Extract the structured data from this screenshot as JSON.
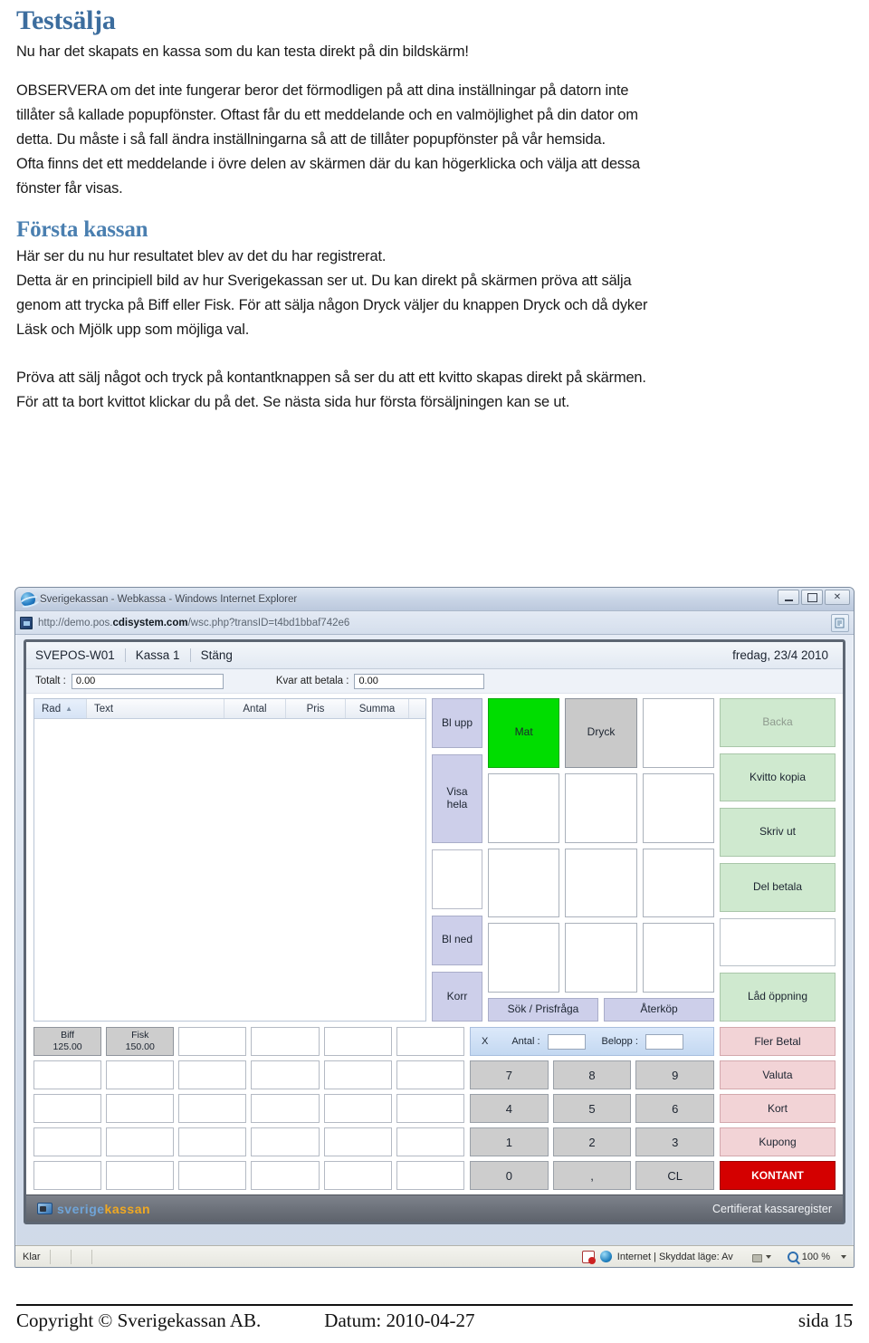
{
  "document": {
    "heading1": "Testsälja",
    "intro": "Nu har det skapats en kassa som du kan testa direkt på din bildskärm!",
    "para1_line1": "OBSERVERA om det inte fungerar beror det förmodligen på att dina inställningar på datorn inte",
    "para1_line2": "tillåter så kallade popupfönster. Oftast får du ett meddelande och en valmöjlighet på din dator om",
    "para1_line3": "detta. Du måste i så fall ändra inställningarna så att de tillåter popupfönster på vår hemsida.",
    "para1_line4": "Ofta finns det ett meddelande i övre delen av skärmen där du kan högerklicka och välja att dessa",
    "para1_line5": "fönster får visas.",
    "heading2": "Första kassan",
    "para2_line1": "Här ser du nu hur resultatet blev av det du har registrerat.",
    "para2_line2": "Detta är en principiell bild av hur Sverigekassan ser ut. Du kan direkt på skärmen pröva att sälja",
    "para2_line3": "genom att trycka på Biff eller Fisk. För att sälja någon Dryck väljer du knappen Dryck och då dyker",
    "para2_line4": "Läsk och Mjölk upp som möjliga val.",
    "para3_line1": "Pröva att sälj något och tryck på kontantknappen så ser du att ett kvitto skapas direkt på skärmen.",
    "para3_line2": "För att ta bort kvittot klickar du på det. Se nästa sida hur första försäljningen kan se ut."
  },
  "browser": {
    "title": "Sverigekassan - Webkassa - Windows Internet Explorer",
    "url_scheme": "http://demo.pos.",
    "url_domain": "cdisystem.com",
    "url_path": "/wsc.php?transID=t4bd1bbaf742e6",
    "minimize_label": "Minimera",
    "maximize_label": "Maximera",
    "close_label": "✕",
    "statusbar": {
      "status": "Klar",
      "zone": "Internet | Skyddat läge: Av",
      "zoom": "100 %"
    }
  },
  "pos": {
    "topbar": {
      "terminal": "SVEPOS-W01",
      "register": "Kassa 1",
      "close": "Stäng",
      "date": "fredag, 23/4 2010"
    },
    "totals": {
      "total_label": "Totalt :",
      "total_value": "0.00",
      "remaining_label": "Kvar att betala :",
      "remaining_value": "0.00"
    },
    "receipt": {
      "columns": [
        "Rad",
        "Text",
        "Antal",
        "Pris",
        "Summa"
      ],
      "rows": []
    },
    "nav_buttons": [
      {
        "label": "Bl upp",
        "style": "nav"
      },
      {
        "label": "Visa\nhela",
        "style": "nav"
      },
      {
        "label": "",
        "style": "blank"
      },
      {
        "label": "Bl ned",
        "style": "nav"
      },
      {
        "label": "Korr",
        "style": "nav"
      }
    ],
    "dept_grid": [
      [
        {
          "label": "Mat",
          "style": "green"
        },
        {
          "label": "Dryck",
          "style": "sel"
        },
        {
          "label": "",
          "style": "plu"
        }
      ],
      [
        {
          "label": "",
          "style": "plu"
        },
        {
          "label": "",
          "style": "plu"
        },
        {
          "label": "",
          "style": "plu"
        }
      ],
      [
        {
          "label": "",
          "style": "plu"
        },
        {
          "label": "",
          "style": "plu"
        },
        {
          "label": "",
          "style": "plu"
        }
      ],
      [
        {
          "label": "",
          "style": "plu"
        },
        {
          "label": "",
          "style": "plu"
        },
        {
          "label": "",
          "style": "plu"
        }
      ]
    ],
    "wide_buttons": [
      "Sök / Prisfråga",
      "Återköp"
    ],
    "function_buttons": [
      {
        "label": "Backa",
        "disabled": true
      },
      {
        "label": "Kvitto kopia",
        "disabled": false
      },
      {
        "label": "Skriv ut",
        "disabled": false
      },
      {
        "label": "Del betala",
        "disabled": false
      },
      {
        "label": "",
        "blank": true
      },
      {
        "label": "Låd öppning",
        "disabled": false
      }
    ],
    "plu_grid": [
      {
        "name": "Biff",
        "price": "125.00",
        "filled": true
      },
      {
        "name": "Fisk",
        "price": "150.00",
        "filled": true
      },
      {
        "name": "",
        "price": "",
        "filled": false
      },
      {
        "name": "",
        "price": "",
        "filled": false
      },
      {
        "name": "",
        "price": "",
        "filled": false
      },
      {
        "name": "",
        "price": "",
        "filled": false
      },
      {
        "name": "",
        "price": "",
        "filled": false
      },
      {
        "name": "",
        "price": "",
        "filled": false
      },
      {
        "name": "",
        "price": "",
        "filled": false
      },
      {
        "name": "",
        "price": "",
        "filled": false
      },
      {
        "name": "",
        "price": "",
        "filled": false
      },
      {
        "name": "",
        "price": "",
        "filled": false
      },
      {
        "name": "",
        "price": "",
        "filled": false
      },
      {
        "name": "",
        "price": "",
        "filled": false
      },
      {
        "name": "",
        "price": "",
        "filled": false
      },
      {
        "name": "",
        "price": "",
        "filled": false
      },
      {
        "name": "",
        "price": "",
        "filled": false
      },
      {
        "name": "",
        "price": "",
        "filled": false
      },
      {
        "name": "",
        "price": "",
        "filled": false
      },
      {
        "name": "",
        "price": "",
        "filled": false
      },
      {
        "name": "",
        "price": "",
        "filled": false
      },
      {
        "name": "",
        "price": "",
        "filled": false
      },
      {
        "name": "",
        "price": "",
        "filled": false
      },
      {
        "name": "",
        "price": "",
        "filled": false
      },
      {
        "name": "",
        "price": "",
        "filled": false
      },
      {
        "name": "",
        "price": "",
        "filled": false
      },
      {
        "name": "",
        "price": "",
        "filled": false
      },
      {
        "name": "",
        "price": "",
        "filled": false
      },
      {
        "name": "",
        "price": "",
        "filled": false
      },
      {
        "name": "",
        "price": "",
        "filled": false
      }
    ],
    "qtybar": {
      "multiply": "X",
      "qty_label": "Antal :",
      "qty_value": "",
      "amount_label": "Belopp :",
      "amount_value": ""
    },
    "numpad": [
      [
        "7",
        "8",
        "9"
      ],
      [
        "4",
        "5",
        "6"
      ],
      [
        "1",
        "2",
        "3"
      ],
      [
        "0",
        ",",
        "CL"
      ]
    ],
    "payment_buttons": [
      {
        "label": "Fler Betal",
        "primary": false
      },
      {
        "label": "Valuta",
        "primary": false
      },
      {
        "label": "Kort",
        "primary": false
      },
      {
        "label": "Kupong",
        "primary": false
      },
      {
        "label": "KONTANT",
        "primary": true
      }
    ],
    "footer": {
      "logo_part1": "sverige",
      "logo_part2": "kassan",
      "certification": "Certifierat kassaregister"
    }
  },
  "page_footer": {
    "copyright": "Copyright © Sverigekassan AB.",
    "date": "Datum: 2010-04-27",
    "page": "sida 15"
  },
  "colors": {
    "heading": "#3c6d9e",
    "nav_button": "#cdcfea",
    "function_button": "#cfe9cf",
    "payment_button": "#f2d3d6",
    "cash_button": "#d40000",
    "dept_selected_green": "#00dd00",
    "dept_selected_gray": "#c9c9c9"
  }
}
